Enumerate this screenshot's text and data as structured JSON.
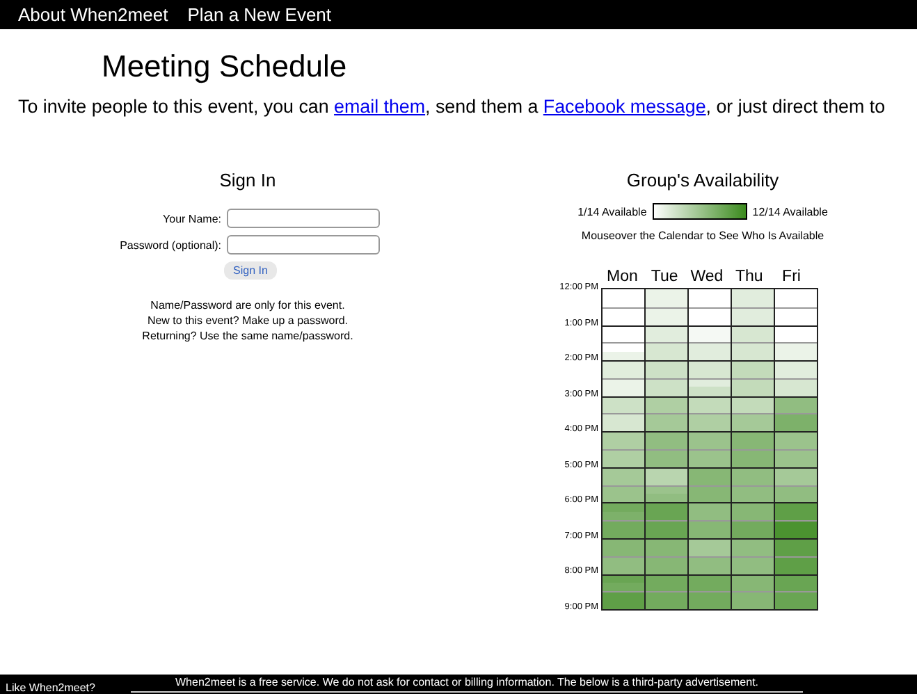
{
  "nav": [
    "About When2meet",
    "Plan a New Event"
  ],
  "title": "Meeting Schedule",
  "invite": {
    "before": "To invite people to this event, you can ",
    "link1": "email them",
    "middle": ", send them a ",
    "link2": "Facebook message",
    "after": ", or just direct them to"
  },
  "sign_in": {
    "heading": "Sign In",
    "fields": [
      {
        "label": "Your Name:"
      },
      {
        "label": "Password (optional):"
      }
    ],
    "button": "Sign In",
    "notes": [
      "Name/Password are only for this event.",
      "New to this event? Make up a password.",
      "Returning? Use the same name/password."
    ]
  },
  "availability": {
    "heading": "Group's Availability",
    "legend_min": "1/14 Available",
    "legend_max": "12/14 Available",
    "hint": "Mouseover the Calendar to See Who Is Available",
    "times": [
      "12:00 PM",
      "1:00 PM",
      "2:00 PM",
      "3:00 PM",
      "4:00 PM",
      "5:00 PM",
      "6:00 PM",
      "7:00 PM",
      "8:00 PM",
      "9:00 PM"
    ],
    "days": [
      "Mon",
      "Tue",
      "Wed",
      "Thu",
      "Fri"
    ]
  },
  "footer": {
    "left": "Like When2meet?",
    "notice": "When2meet is a free service. We do not ask for contact or billing information. The below is a third-party advertisement."
  }
}
